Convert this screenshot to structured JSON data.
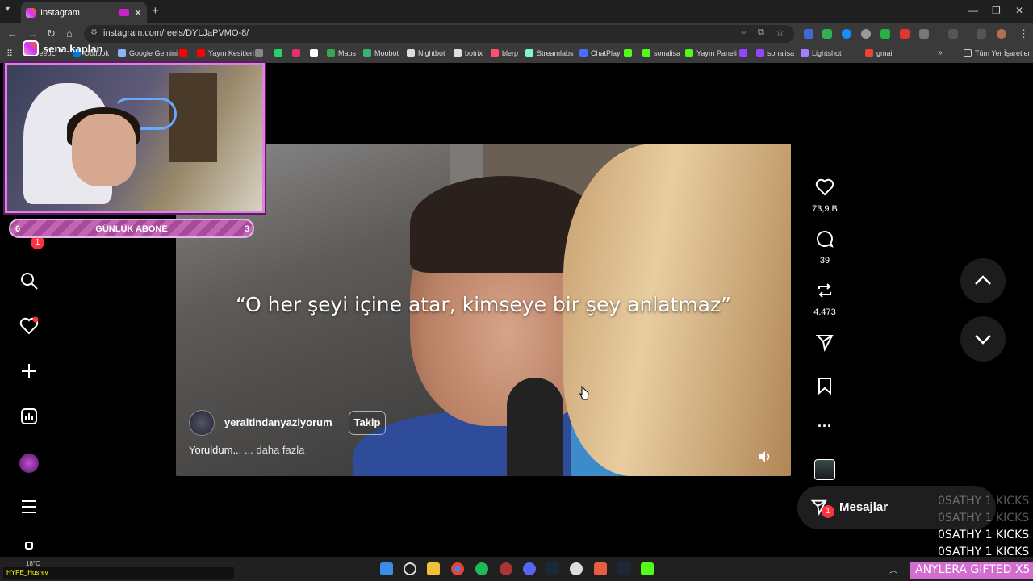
{
  "browser": {
    "tab_title": "Instagram",
    "url": "instagram.com/reels/DYLJaPVMO-8/",
    "new_tab": "+",
    "tab_close": "✕"
  },
  "bookmarks": [
    {
      "label": "DeepL",
      "color": "#1b3d6e"
    },
    {
      "label": "Outlook",
      "color": "#0078d4"
    },
    {
      "label": "Google Gemini",
      "color": "#8ab4f8"
    },
    {
      "label": "",
      "color": "#ff0000"
    },
    {
      "label": "Yayın Kesitleri",
      "color": "#ff0000"
    },
    {
      "label": "",
      "color": "#888888"
    },
    {
      "label": "",
      "color": "#25d366"
    },
    {
      "label": "",
      "color": "#e1306c"
    },
    {
      "label": "",
      "color": "#ffffff"
    },
    {
      "label": "Maps",
      "color": "#34a853"
    },
    {
      "label": "Moobot",
      "color": "#3bb273"
    },
    {
      "label": "Nightbot",
      "color": "#dddddd"
    },
    {
      "label": "botrix",
      "color": "#dddddd"
    },
    {
      "label": "blerp",
      "color": "#ff4f6d"
    },
    {
      "label": "Streamlabs",
      "color": "#80f5d2"
    },
    {
      "label": "ChatPlay",
      "color": "#4a6cff"
    },
    {
      "label": "",
      "color": "#53fc18"
    },
    {
      "label": "sonalisa",
      "color": "#53fc18"
    },
    {
      "label": "Yayın Paneli",
      "color": "#53fc18"
    },
    {
      "label": "",
      "color": "#9146ff"
    },
    {
      "label": "sonalisa",
      "color": "#9146ff"
    },
    {
      "label": "Lightshot",
      "color": "#a77dff"
    },
    {
      "label": "gmail",
      "color": "#ea4335"
    }
  ],
  "bookmarks_right": "Tüm Yer İşaretleri",
  "overlay": {
    "channel": "sena.kaplan",
    "sub_goal_label": "GÜNLÜK ABONE",
    "sub_left": "6",
    "sub_right": "3"
  },
  "nav": {
    "notification_badge": "1"
  },
  "reel": {
    "subtitle": "“O her şeyi içine atar, kimseye bir şey anlatmaz”",
    "author": "yeraltindanyaziyorum",
    "follow_label": "Takip",
    "caption": "Yoruldum...",
    "more_label": "... daha fazla"
  },
  "actions": {
    "likes": "73,9 B",
    "comments": "39",
    "reposts": "4.473"
  },
  "messages": {
    "label": "Mesajlar",
    "badge": "1"
  },
  "kick_alerts": [
    "0SATHY  1 KICKS",
    "0SATHY  1 KICKS",
    "0SATHY  1 KICKS",
    "0SATHY  1 KICKS"
  ],
  "taskbar": {
    "weather": "18°C",
    "hype_label": "HYPE_Husrev",
    "gift_banner": "ANYLERA  GIFTED X5"
  }
}
